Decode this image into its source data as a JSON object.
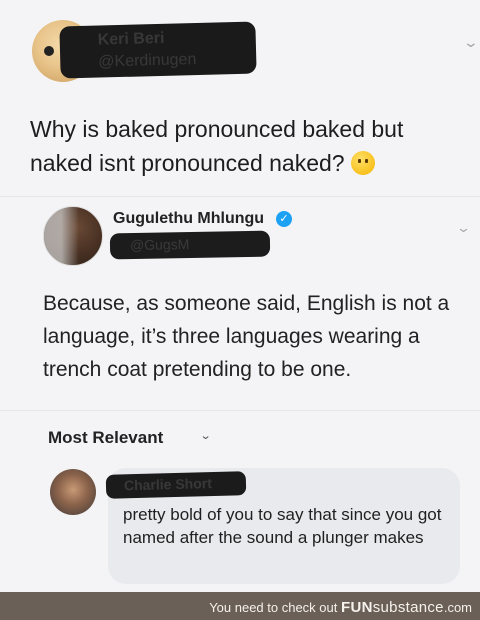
{
  "tweet1": {
    "author_name": "Keri Beri",
    "author_handle": "@Kerdinugen",
    "text": "Why is baked pronounced baked but naked isnt pronounced naked?",
    "emoji_icon": "thinking-face-icon"
  },
  "tweet2": {
    "author_name": "Gugulethu Mhlungu",
    "author_handle": "@GugsM",
    "verified_icon": "verified-badge-icon",
    "text": "Because, as someone said, English is not a language, it’s three languages wearing a trench coat pretending to be one."
  },
  "comments": {
    "sort_label": "Most Relevant",
    "items": [
      {
        "author_name": "Charlie Short",
        "text": "pretty bold of you to say that since you got named after the sound a plunger makes"
      }
    ]
  },
  "footer": {
    "prefix": "You need to check out",
    "brand_bold": "FUN",
    "brand_rest": "substance",
    "domain": ".com"
  },
  "colors": {
    "verified_blue": "#1da1f2",
    "footer_bg": "#6b6057",
    "comment_bubble": "#e9eaee"
  }
}
